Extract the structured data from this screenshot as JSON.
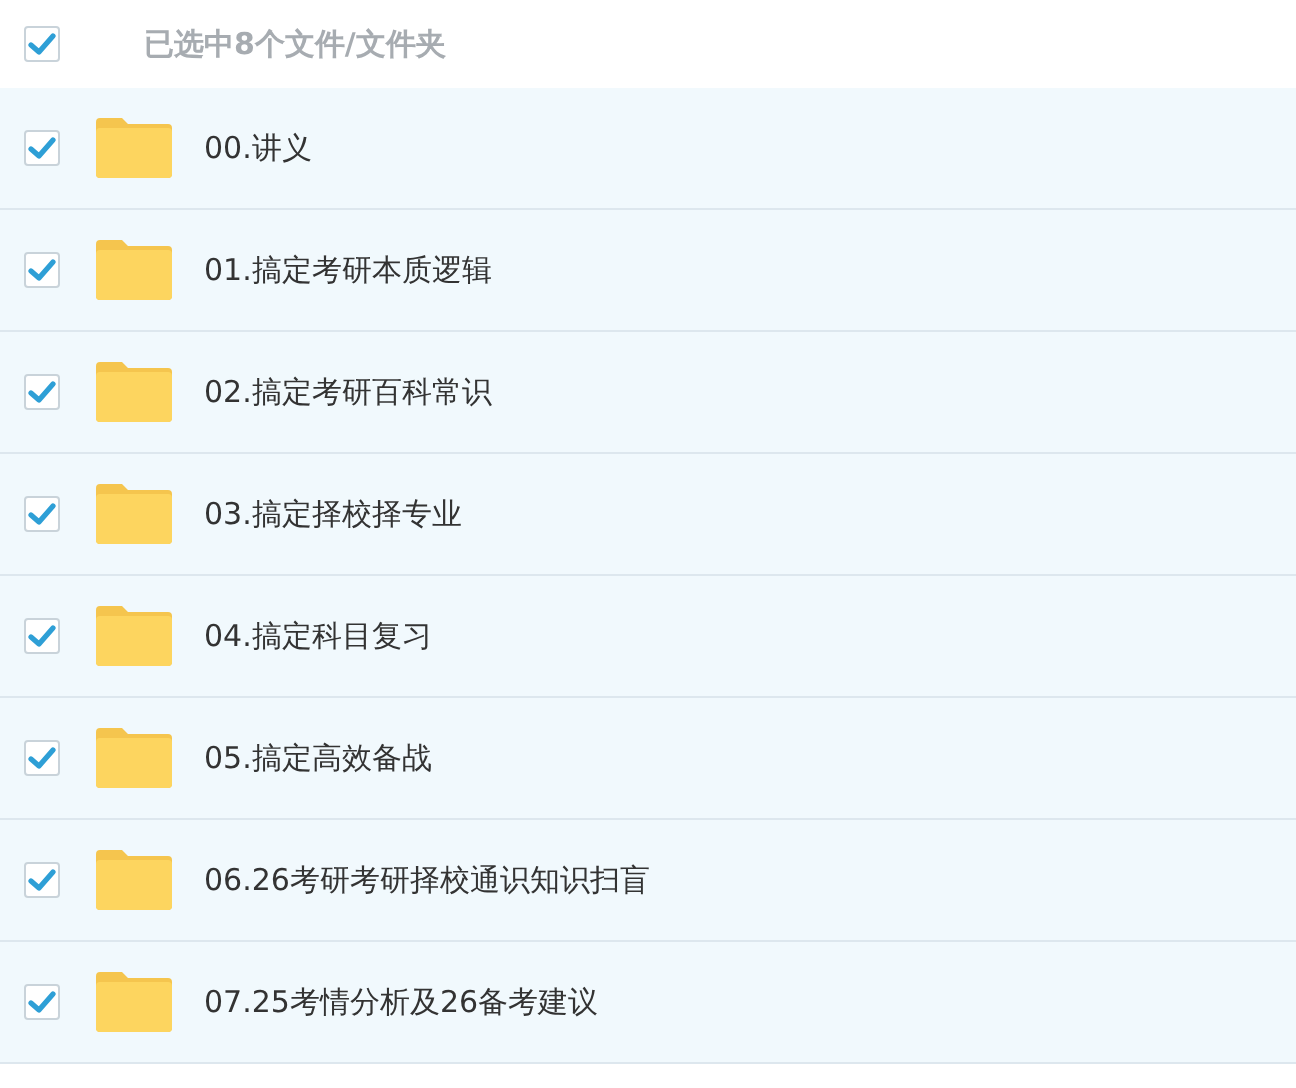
{
  "header": {
    "checked": true,
    "label": "已选中8个文件/文件夹"
  },
  "files": [
    {
      "name": "00.讲义",
      "checked": true
    },
    {
      "name": "01.搞定考研本质逻辑",
      "checked": true
    },
    {
      "name": "02.搞定考研百科常识",
      "checked": true
    },
    {
      "name": "03.搞定择校择专业",
      "checked": true
    },
    {
      "name": "04.搞定科目复习",
      "checked": true
    },
    {
      "name": "05.搞定高效备战",
      "checked": true
    },
    {
      "name": "06.26考研考研择校通识知识扫盲",
      "checked": true
    },
    {
      "name": "07.25考情分析及26备考建议",
      "checked": true
    }
  ]
}
